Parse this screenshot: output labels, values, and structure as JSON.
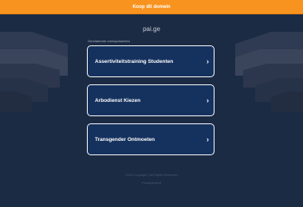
{
  "banner": {
    "label": "Koop dit domein"
  },
  "header": {
    "domain": "pai.ge"
  },
  "related": {
    "label": "Gerelateerde zoekopdrachten",
    "items": [
      {
        "label": "Assertiviteitstraining Studenten"
      },
      {
        "label": "Arbodienst Kiezen"
      },
      {
        "label": "Transgender Ontmoeten"
      }
    ]
  },
  "footer": {
    "copyright": "2023 Copyright | All Rights Reserved",
    "privacy": "Privacybeleid"
  },
  "colors": {
    "background": "#1c2b44",
    "banner": "#f7931e",
    "button_fill": "#15325f",
    "button_border": "#ffffff"
  },
  "icons": {
    "chevron": "chevron-right-icon"
  }
}
